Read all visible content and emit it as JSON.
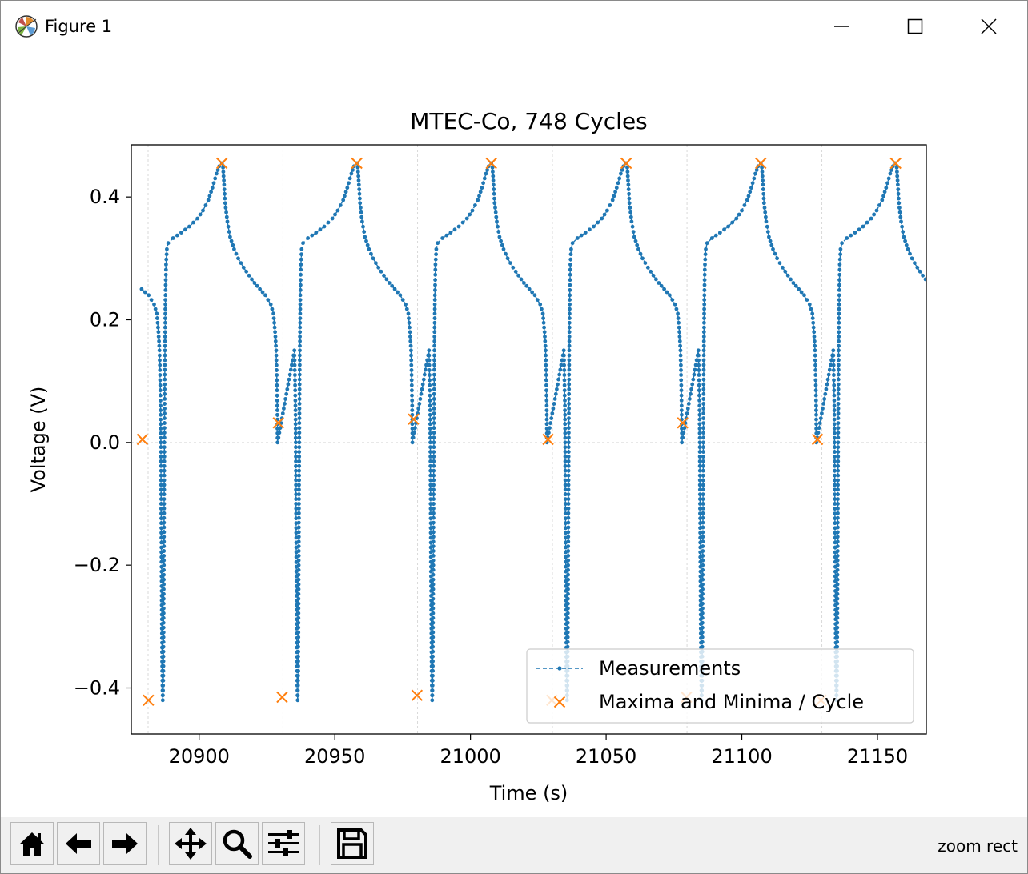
{
  "window": {
    "title": "Figure 1",
    "controls": {
      "minimize": "minimize",
      "maximize": "maximize",
      "close": "close"
    }
  },
  "toolbar": {
    "buttons": [
      {
        "icon": "home-icon",
        "tooltip": "Reset original view"
      },
      {
        "icon": "back-arrow-icon",
        "tooltip": "Back to previous view"
      },
      {
        "icon": "forward-arrow-icon",
        "tooltip": "Forward to next view"
      },
      {
        "icon": "pan-icon",
        "tooltip": "Pan axes"
      },
      {
        "icon": "zoom-icon",
        "tooltip": "Zoom to rectangle"
      },
      {
        "icon": "subplots-icon",
        "tooltip": "Configure subplots"
      },
      {
        "icon": "save-icon",
        "tooltip": "Save the figure"
      }
    ],
    "status": "zoom rect"
  },
  "chart_data": {
    "type": "line",
    "title": "MTEC-Co, 748 Cycles",
    "xlabel": "Time (s)",
    "ylabel": "Voltage (V)",
    "xlim": [
      20875,
      21168
    ],
    "ylim": [
      -0.475,
      0.485
    ],
    "xticks": [
      20900,
      20950,
      21000,
      21050,
      21100,
      21150
    ],
    "xtick_labels": [
      "20900",
      "20950",
      "21000",
      "21050",
      "21100",
      "21150"
    ],
    "yticks": [
      -0.4,
      -0.2,
      0.0,
      0.2,
      0.4
    ],
    "ytick_labels": [
      "−0.4",
      "−0.2",
      "0.0",
      "0.2",
      "0.4"
    ],
    "grid": true,
    "legend_position": "lower right",
    "colors": {
      "measurements": "#1f77b4",
      "extrema": "#ff7f0e"
    },
    "cycle_period_s": 49.66,
    "cycle_template": [
      [
        -29.6,
        0.25
      ],
      [
        -27.0,
        0.24
      ],
      [
        -25.0,
        0.225
      ],
      [
        -24.0,
        0.21
      ],
      [
        -23.4,
        0.18
      ],
      [
        -23.0,
        0.15
      ],
      [
        -22.8,
        0.11
      ],
      [
        -22.6,
        0.06
      ],
      [
        -22.5,
        0.0
      ],
      [
        -22.4,
        -0.1
      ],
      [
        -22.2,
        -0.25
      ],
      [
        -22.0,
        -0.38
      ],
      [
        -21.8,
        -0.42
      ],
      [
        -21.6,
        -0.38
      ],
      [
        -21.4,
        -0.2
      ],
      [
        -21.2,
        0.0
      ],
      [
        -21.0,
        0.15
      ],
      [
        -20.8,
        0.24
      ],
      [
        -20.6,
        0.29
      ],
      [
        -20.3,
        0.315
      ],
      [
        -19.8,
        0.325
      ],
      [
        -18.0,
        0.333
      ],
      [
        -15.0,
        0.342
      ],
      [
        -12.0,
        0.352
      ],
      [
        -9.0,
        0.365
      ],
      [
        -7.0,
        0.378
      ],
      [
        -5.0,
        0.395
      ],
      [
        -3.5,
        0.415
      ],
      [
        -2.0,
        0.438
      ],
      [
        -1.0,
        0.45
      ],
      [
        0.0,
        0.455
      ],
      [
        0.4,
        0.448
      ],
      [
        0.8,
        0.42
      ],
      [
        1.2,
        0.39
      ],
      [
        2.0,
        0.36
      ],
      [
        3.0,
        0.335
      ],
      [
        4.5,
        0.315
      ],
      [
        6.0,
        0.3
      ],
      [
        8.0,
        0.285
      ],
      [
        10.0,
        0.272
      ],
      [
        12.0,
        0.26
      ],
      [
        14.0,
        0.25
      ],
      [
        16.0,
        0.24
      ],
      [
        18.0,
        0.225
      ],
      [
        19.0,
        0.21
      ],
      [
        19.6,
        0.18
      ],
      [
        20.0,
        0.15
      ],
      [
        20.2,
        0.11
      ],
      [
        20.4,
        0.06
      ],
      [
        20.5,
        0.0
      ]
    ],
    "series": [
      {
        "name": "Measurements",
        "style": "dashed line with dot markers",
        "cycle_peak_times": [
          20908.4,
          20958.1,
          21007.7,
          21057.4,
          21107.0,
          21156.7
        ]
      },
      {
        "name": "Maxima and Minima / Cycle",
        "style": "x markers",
        "points": [
          {
            "x": 20879.1,
            "y": 0.005
          },
          {
            "x": 20881.3,
            "y": -0.42
          },
          {
            "x": 20908.4,
            "y": 0.455
          },
          {
            "x": 20929.2,
            "y": 0.032
          },
          {
            "x": 20930.6,
            "y": -0.415
          },
          {
            "x": 20958.1,
            "y": 0.455
          },
          {
            "x": 20979.0,
            "y": 0.038
          },
          {
            "x": 20980.3,
            "y": -0.412
          },
          {
            "x": 21007.7,
            "y": 0.455
          },
          {
            "x": 21028.6,
            "y": 0.005
          },
          {
            "x": 21030.0,
            "y": -0.42
          },
          {
            "x": 21057.4,
            "y": 0.455
          },
          {
            "x": 21078.2,
            "y": 0.032
          },
          {
            "x": 21079.6,
            "y": -0.415
          },
          {
            "x": 21107.0,
            "y": 0.455
          },
          {
            "x": 21127.9,
            "y": 0.005
          },
          {
            "x": 21129.2,
            "y": -0.42
          },
          {
            "x": 21156.7,
            "y": 0.455
          }
        ]
      }
    ]
  }
}
